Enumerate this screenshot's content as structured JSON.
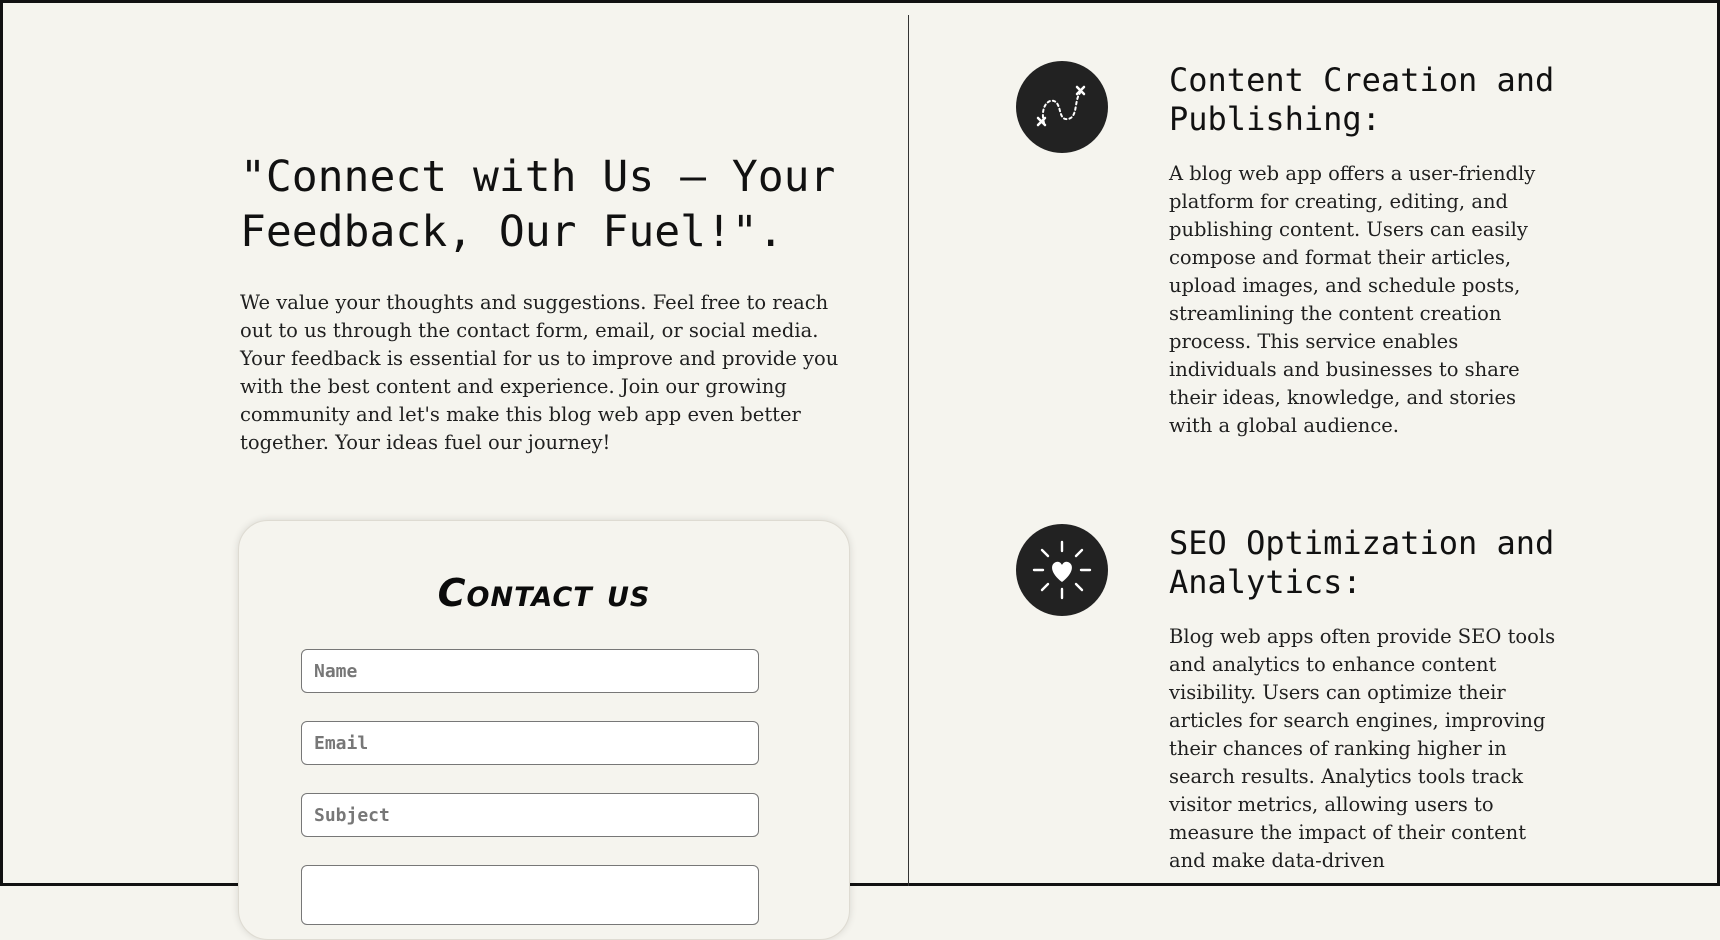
{
  "hero": {
    "title": "\"Connect with Us – Your Feedback, Our Fuel!\".",
    "description": "We value your thoughts and suggestions. Feel free to reach out to us through the contact form, email, or social media. Your feedback is essential for us to improve and provide you with the best content and experience. Join our growing community and let's make this blog web app even better together. Your ideas fuel our journey!"
  },
  "contact": {
    "title": "Contact us",
    "fields": {
      "name_placeholder": "Name",
      "email_placeholder": "Email",
      "subject_placeholder": "Subject"
    }
  },
  "services": [
    {
      "icon": "route-path-icon",
      "title": "Content Creation and Publishing:",
      "text": "A blog web app offers a user-friendly platform for creating, editing, and publishing content. Users can easily compose and format their articles, upload images, and schedule posts, streamlining the content creation process. This service enables individuals and businesses to share their ideas, knowledge, and stories with a global audience."
    },
    {
      "icon": "heart-burst-icon",
      "title": "SEO Optimization and Analytics:",
      "text": "Blog web apps often provide SEO tools and analytics to enhance content visibility. Users can optimize their articles for search engines, improving their chances of ranking higher in search results. Analytics tools track visitor metrics, allowing users to measure the impact of their content and make data-driven"
    }
  ],
  "colors": {
    "background": "#f5f4ee",
    "icon_circle": "#222222",
    "text": "#1f1f1f"
  }
}
